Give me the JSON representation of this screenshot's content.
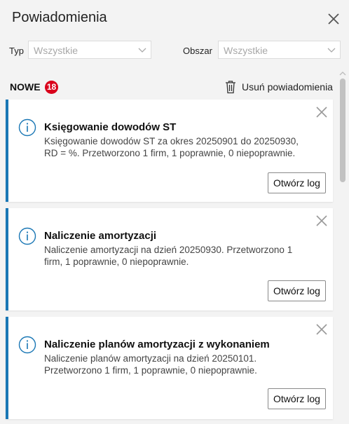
{
  "header": {
    "title": "Powiadomienia"
  },
  "filters": {
    "type_label": "Typ",
    "type_value": "Wszystkie",
    "area_label": "Obszar",
    "area_value": "Wszystkie"
  },
  "toolbar": {
    "new_label": "NOWE",
    "new_count": "18",
    "delete_label": "Usuń powiadomienia"
  },
  "notifications": [
    {
      "title": "Księgowanie dowodów ST",
      "body": "Księgowanie dowodów ST za okres 20250901 do 20250930, RD = %. Przetworzono 1 firm, 1 poprawnie, 0 niepoprawnie.",
      "button": "Otwórz log"
    },
    {
      "title": "Naliczenie amortyzacji",
      "body": "Naliczenie amortyzacji na dzień  20250930. Przetworzono 1 firm, 1 poprawnie, 0 niepoprawnie.",
      "button": "Otwórz log"
    },
    {
      "title": "Naliczenie planów amortyzacji z wykonaniem",
      "body": "Naliczenie planów amortyzacji na dzień  20250101. Przetworzono 1 firm, 1 poprawnie, 0 niepoprawnie.",
      "button": "Otwórz log"
    }
  ],
  "colors": {
    "accent": "#1a77b5",
    "badge": "#d9001b"
  }
}
